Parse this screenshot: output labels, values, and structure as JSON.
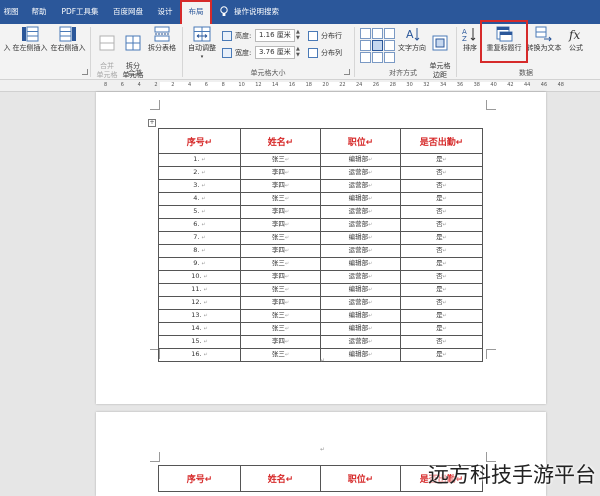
{
  "tabs": [
    "视图",
    "帮助",
    "PDF工具集",
    "百度网盘",
    "设计",
    "布局"
  ],
  "tell_me": "操作说明搜索",
  "ribbon": {
    "insert_left": "在左侧插入",
    "insert_right": "在右侧插入",
    "merge_cells": "合并\n单元格",
    "split_cells": "拆分\n单元格",
    "split_table": "拆分表格",
    "merge_group": "合并",
    "autofit": "自动调整",
    "height_label": "高度:",
    "height_value": "1.16 厘米",
    "width_label": "宽度:",
    "width_value": "3.76 厘米",
    "distribute_rows": "分布行",
    "distribute_cols": "分布列",
    "cell_size_group": "单元格大小",
    "text_direction": "文字方向",
    "cell_margins": "单元格\n边距",
    "alignment_group": "对齐方式",
    "sort": "排序",
    "repeat_header": "重复标题行",
    "convert_text": "转换为文本",
    "formula": "公式",
    "data_group": "数据"
  },
  "ruler_numbers": [
    "8",
    "6",
    "4",
    "2",
    "2",
    "4",
    "6",
    "8",
    "10",
    "12",
    "14",
    "16",
    "18",
    "20",
    "22",
    "24",
    "26",
    "28",
    "30",
    "32",
    "34",
    "36",
    "38",
    "40",
    "42",
    "44",
    "46",
    "48"
  ],
  "table": {
    "headers": [
      "序号",
      "姓名",
      "职位",
      "是否出勤"
    ],
    "rows": [
      [
        "1.",
        "张三",
        "编辑部",
        "是"
      ],
      [
        "2.",
        "李四",
        "运营部",
        "否"
      ],
      [
        "3.",
        "李四",
        "运营部",
        "否"
      ],
      [
        "4.",
        "张三",
        "编辑部",
        "是"
      ],
      [
        "5.",
        "李四",
        "运营部",
        "否"
      ],
      [
        "6.",
        "李四",
        "运营部",
        "否"
      ],
      [
        "7.",
        "张三",
        "编辑部",
        "是"
      ],
      [
        "8.",
        "李四",
        "运营部",
        "否"
      ],
      [
        "9.",
        "张三",
        "编辑部",
        "是"
      ],
      [
        "10.",
        "李四",
        "运营部",
        "否"
      ],
      [
        "11.",
        "张三",
        "编辑部",
        "是"
      ],
      [
        "12.",
        "李四",
        "运营部",
        "否"
      ],
      [
        "13.",
        "张三",
        "编辑部",
        "是"
      ],
      [
        "14.",
        "张三",
        "编辑部",
        "是"
      ],
      [
        "15.",
        "李四",
        "运营部",
        "否"
      ],
      [
        "16.",
        "张三",
        "编辑部",
        "是"
      ]
    ]
  },
  "mark": "↵",
  "watermark": "远方科技手游平台",
  "colors": {
    "tabbar": "#2b579a",
    "header_text": "#d62a2a",
    "highlight": "#d62a2a"
  }
}
